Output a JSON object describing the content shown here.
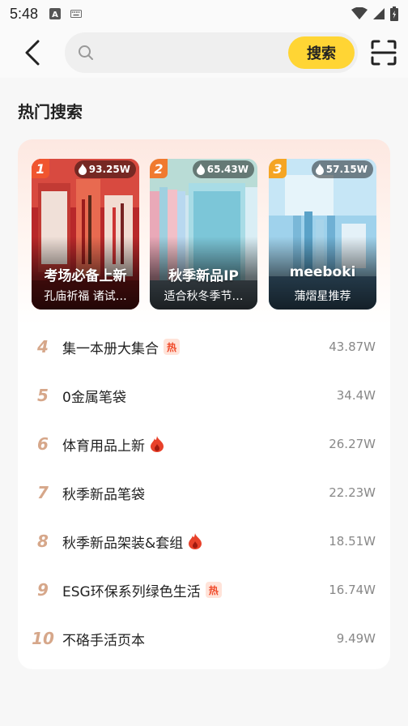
{
  "status_bar": {
    "time": "5:48"
  },
  "search": {
    "placeholder": "",
    "button_label": "搜索"
  },
  "section": {
    "title": "热门搜索"
  },
  "featured": [
    {
      "rank": "1",
      "heat": "93.25W",
      "title": "考场必备上新",
      "subtitle": "孔庙祈福 诸试…",
      "tag_color": "#f0552f"
    },
    {
      "rank": "2",
      "heat": "65.43W",
      "title": "秋季新品IP",
      "subtitle": "适合秋冬季节…",
      "tag_color": "#f07a2f"
    },
    {
      "rank": "3",
      "heat": "57.15W",
      "title": "meeboki",
      "subtitle": "蒲熠星推荐",
      "tag_color": "#f5a524"
    }
  ],
  "list": [
    {
      "rank": "4",
      "label": "集一本册大集合",
      "badge": "hot",
      "badge_text": "热",
      "heat": "43.87W"
    },
    {
      "rank": "5",
      "label": "0金属笔袋",
      "badge": "",
      "heat": "34.4W"
    },
    {
      "rank": "6",
      "label": "体育用品上新",
      "badge": "fire",
      "heat": "26.27W"
    },
    {
      "rank": "7",
      "label": "秋季新品笔袋",
      "badge": "",
      "heat": "22.23W"
    },
    {
      "rank": "8",
      "label": "秋季新品架装&套组",
      "badge": "fire",
      "heat": "18.51W"
    },
    {
      "rank": "9",
      "label": "ESG环保系列绿色生活",
      "badge": "hot",
      "badge_text": "热",
      "heat": "16.74W"
    },
    {
      "rank": "10",
      "label": "不硌手活页本",
      "badge": "",
      "heat": "9.49W"
    }
  ],
  "icons": {
    "back": "chevron-left-icon",
    "search": "search-icon",
    "scan": "scan-icon",
    "flame": "flame-icon"
  },
  "colors": {
    "accent": "#ffd534",
    "rank_color": "#d6a78a",
    "fire": "#e8412a"
  }
}
